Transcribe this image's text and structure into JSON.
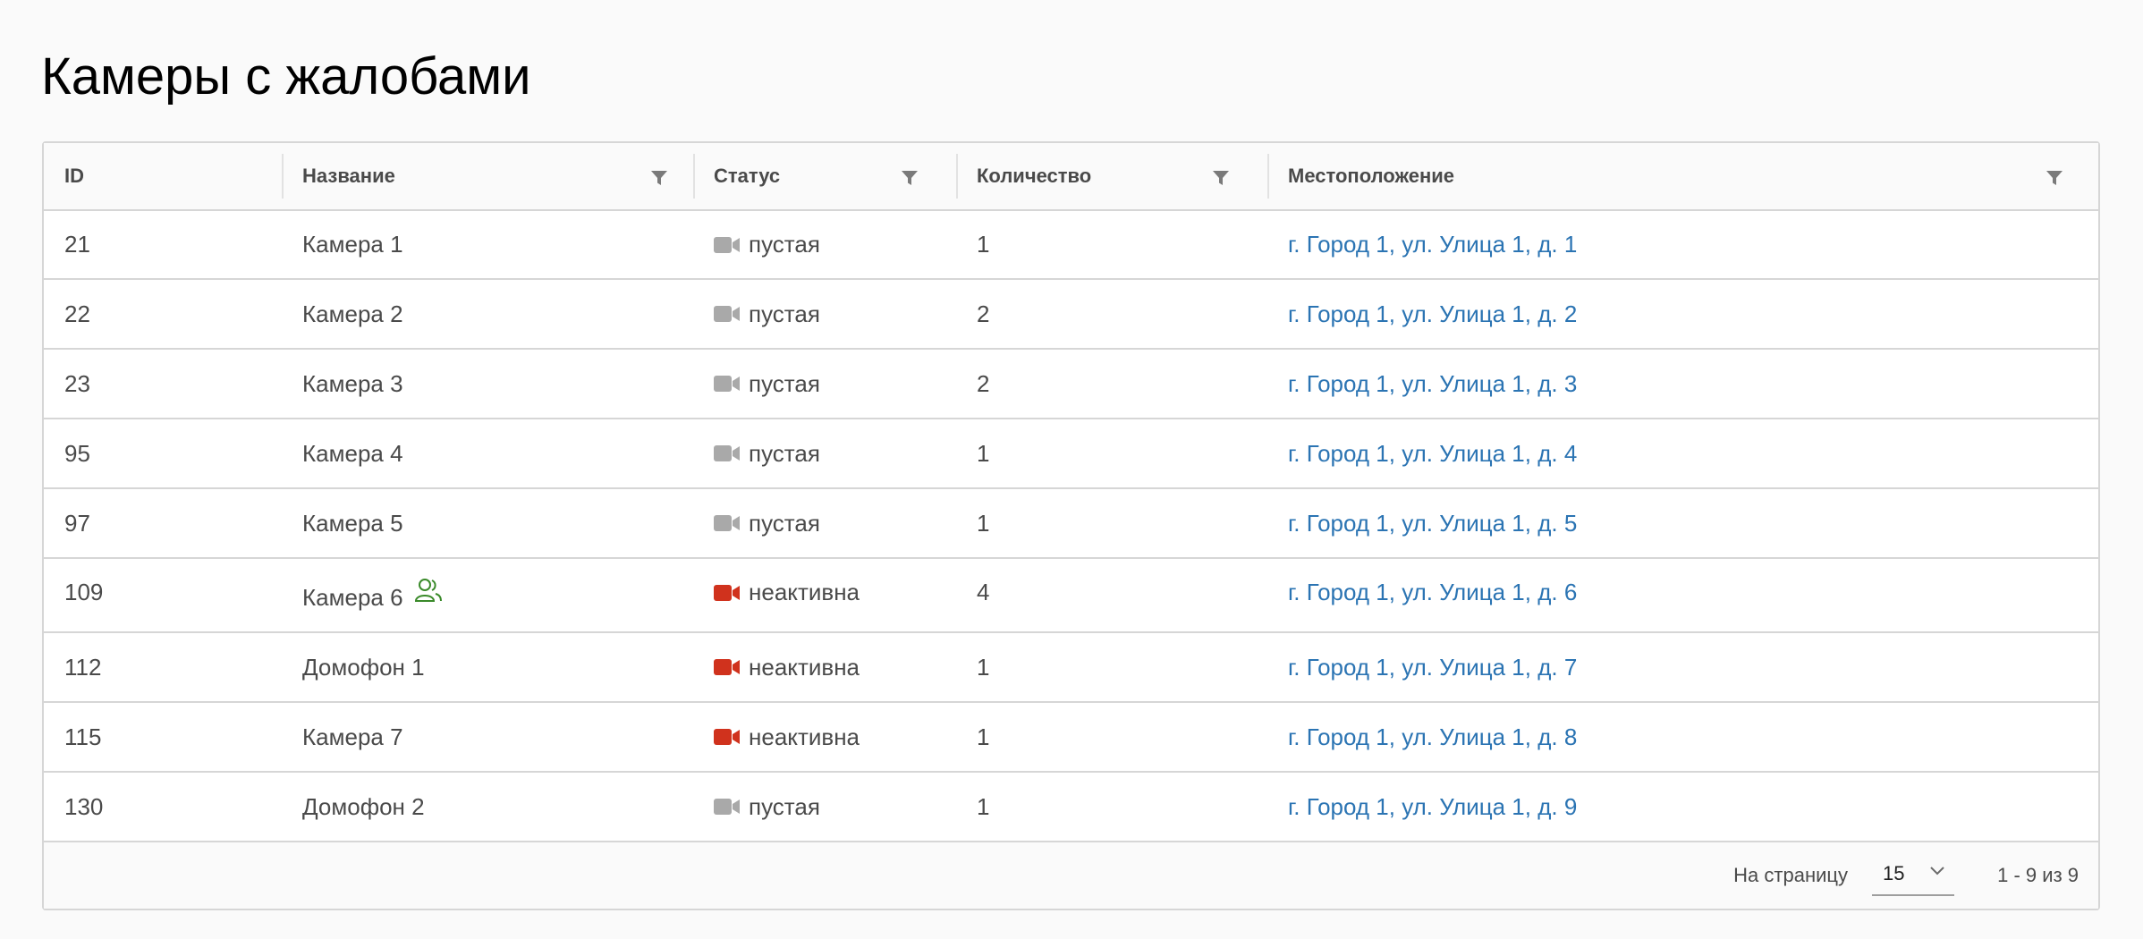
{
  "page": {
    "title": "Камеры с жалобами"
  },
  "columns": {
    "id": "ID",
    "name": "Название",
    "status": "Статус",
    "count": "Количество",
    "location": "Местоположение"
  },
  "colors": {
    "status_empty": "#a9a9a9",
    "status_inactive": "#d0321d",
    "link": "#2b74b3",
    "person_icon": "#3a8a2a"
  },
  "rows": [
    {
      "id": "21",
      "name": "Камера 1",
      "status": "пустая",
      "status_key": "empty",
      "count": "1",
      "location": "г. Город 1, ул. Улица 1, д. 1",
      "has_person_icon": false
    },
    {
      "id": "22",
      "name": "Камера 2",
      "status": "пустая",
      "status_key": "empty",
      "count": "2",
      "location": "г. Город 1, ул. Улица 1, д. 2",
      "has_person_icon": false
    },
    {
      "id": "23",
      "name": "Камера 3",
      "status": "пустая",
      "status_key": "empty",
      "count": "2",
      "location": "г. Город 1, ул. Улица 1, д. 3",
      "has_person_icon": false
    },
    {
      "id": "95",
      "name": "Камера 4",
      "status": "пустая",
      "status_key": "empty",
      "count": "1",
      "location": "г. Город 1, ул. Улица 1, д. 4",
      "has_person_icon": false
    },
    {
      "id": "97",
      "name": "Камера 5",
      "status": "пустая",
      "status_key": "empty",
      "count": "1",
      "location": "г. Город 1, ул. Улица 1, д. 5",
      "has_person_icon": false
    },
    {
      "id": "109",
      "name": "Камера 6",
      "status": "неактивна",
      "status_key": "inactive",
      "count": "4",
      "location": "г. Город 1, ул. Улица 1, д. 6",
      "has_person_icon": true
    },
    {
      "id": "112",
      "name": "Домофон 1",
      "status": "неактивна",
      "status_key": "inactive",
      "count": "1",
      "location": "г. Город 1, ул. Улица 1, д. 7",
      "has_person_icon": false
    },
    {
      "id": "115",
      "name": "Камера 7",
      "status": "неактивна",
      "status_key": "inactive",
      "count": "1",
      "location": "г. Город 1, ул. Улица 1, д. 8",
      "has_person_icon": false
    },
    {
      "id": "130",
      "name": "Домофон 2",
      "status": "пустая",
      "status_key": "empty",
      "count": "1",
      "location": "г. Город 1, ул. Улица 1, д. 9",
      "has_person_icon": false
    }
  ],
  "pager": {
    "per_page_label": "На страницу",
    "per_page_value": "15",
    "range_text": "1 - 9 из 9"
  },
  "icons": {
    "filter": "filter-icon",
    "camera": "video-camera-icon",
    "person": "users-icon",
    "chevron": "chevron-down-icon"
  }
}
